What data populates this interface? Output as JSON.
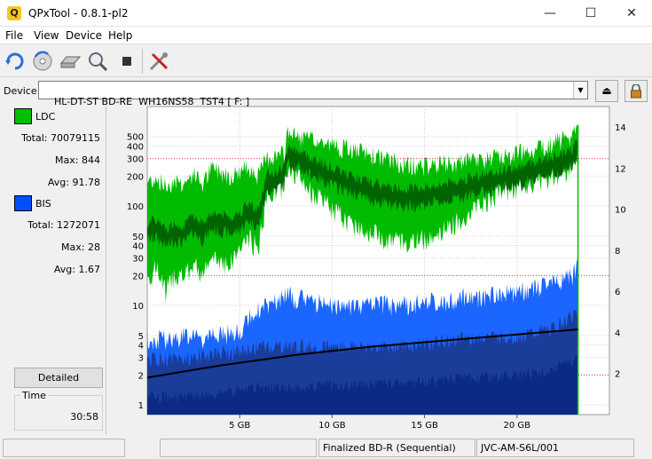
{
  "window": {
    "title": "QPxTool - 0.8.1-pl2",
    "app_icon_glyph": "Q"
  },
  "menu": {
    "items": [
      "File",
      "View",
      "Device",
      "Help"
    ]
  },
  "toolbar": {
    "icons": [
      "refresh-icon",
      "disc-scan-icon",
      "drive-icon",
      "magnifier-icon",
      "stop-icon",
      "tools-icon"
    ]
  },
  "device": {
    "label": "Device:",
    "value": "HL-DT-ST BD-RE  WH16NS58  TST4 [ F: ]"
  },
  "legend": {
    "ldc": {
      "name": "LDC",
      "color": "#00c000",
      "total_label": "Total:",
      "total": "70079115",
      "max_label": "Max:",
      "max": "844",
      "avg_label": "Avg:",
      "avg": "91.78"
    },
    "bis": {
      "name": "BIS",
      "color": "#0050ff",
      "total_label": "Total:",
      "total": "1272071",
      "max_label": "Max:",
      "max": "28",
      "avg_label": "Avg:",
      "avg": "1.67"
    }
  },
  "detailed_button": "Detailed",
  "time": {
    "label": "Time",
    "value": "30:58"
  },
  "status": {
    "pane3": "Finalized BD-R (Sequential)",
    "pane4": "JVC-AM-S6L/001"
  },
  "chart_data": {
    "type": "area",
    "x_unit": "GB",
    "x_range": [
      0,
      25
    ],
    "x_ticks": [
      5,
      10,
      15,
      20
    ],
    "x_tick_labels": [
      "5 GB",
      "10 GB",
      "15 GB",
      "20 GB"
    ],
    "y_left_ticks": [
      1,
      2,
      3,
      4,
      5,
      10,
      20,
      30,
      40,
      50,
      100,
      200,
      300,
      400,
      500
    ],
    "y_left_scale": "log",
    "y_left_range": [
      0.8,
      1000
    ],
    "y_right_ticks": [
      2,
      4,
      6,
      8,
      10,
      12,
      14
    ],
    "y_right_range": [
      0,
      15
    ],
    "red_dotted_lines": [
      300,
      20,
      2
    ],
    "colors": {
      "ldc_max": "#00bb00",
      "ldc_avg": "#006400",
      "bis_max": "#1a66ff",
      "bis_avg": "#1a3d9a",
      "bis_low": "#0a2a86",
      "speed": "#000000"
    },
    "ldc_max": [
      [
        0.0,
        180
      ],
      [
        0.5,
        200
      ],
      [
        1.0,
        160
      ],
      [
        1.5,
        190
      ],
      [
        2.0,
        170
      ],
      [
        2.5,
        220
      ],
      [
        3.0,
        170
      ],
      [
        3.5,
        250
      ],
      [
        4.0,
        230
      ],
      [
        4.5,
        210
      ],
      [
        5.0,
        230
      ],
      [
        5.5,
        260
      ],
      [
        6.0,
        210
      ],
      [
        6.5,
        320
      ],
      [
        7.0,
        330
      ],
      [
        7.4,
        340
      ],
      [
        7.6,
        600
      ],
      [
        8.0,
        520
      ],
      [
        9.0,
        470
      ],
      [
        10.0,
        420
      ],
      [
        11.0,
        380
      ],
      [
        12.0,
        340
      ],
      [
        13.0,
        300
      ],
      [
        14.0,
        270
      ],
      [
        15.0,
        260
      ],
      [
        16.0,
        270
      ],
      [
        17.0,
        280
      ],
      [
        18.0,
        300
      ],
      [
        19.0,
        320
      ],
      [
        20.0,
        350
      ],
      [
        21.0,
        400
      ],
      [
        22.0,
        450
      ],
      [
        23.0,
        520
      ],
      [
        23.3,
        650
      ]
    ],
    "ldc_mean": [
      [
        0.0,
        70
      ],
      [
        0.5,
        75
      ],
      [
        1.0,
        60
      ],
      [
        1.5,
        70
      ],
      [
        2.0,
        65
      ],
      [
        2.5,
        85
      ],
      [
        3.0,
        70
      ],
      [
        3.5,
        90
      ],
      [
        4.0,
        85
      ],
      [
        4.5,
        80
      ],
      [
        5.0,
        90
      ],
      [
        5.5,
        110
      ],
      [
        6.0,
        95
      ],
      [
        6.5,
        220
      ],
      [
        7.0,
        230
      ],
      [
        7.4,
        260
      ],
      [
        7.6,
        420
      ],
      [
        8.0,
        380
      ],
      [
        9.0,
        310
      ],
      [
        10.0,
        250
      ],
      [
        11.0,
        210
      ],
      [
        12.0,
        180
      ],
      [
        13.0,
        160
      ],
      [
        14.0,
        155
      ],
      [
        15.0,
        160
      ],
      [
        16.0,
        170
      ],
      [
        17.0,
        190
      ],
      [
        18.0,
        210
      ],
      [
        19.0,
        230
      ],
      [
        20.0,
        250
      ],
      [
        21.0,
        290
      ],
      [
        22.0,
        330
      ],
      [
        23.0,
        380
      ],
      [
        23.3,
        480
      ]
    ],
    "ldc_min": [
      [
        0.0,
        20
      ],
      [
        0.5,
        25
      ],
      [
        1.0,
        15
      ],
      [
        1.5,
        22
      ],
      [
        2.0,
        20
      ],
      [
        2.5,
        28
      ],
      [
        3.0,
        22
      ],
      [
        3.5,
        30
      ],
      [
        4.0,
        30
      ],
      [
        4.5,
        28
      ],
      [
        5.0,
        40
      ],
      [
        5.5,
        50
      ],
      [
        6.0,
        40
      ],
      [
        6.5,
        140
      ],
      [
        7.0,
        150
      ],
      [
        7.4,
        170
      ],
      [
        7.6,
        280
      ],
      [
        8.0,
        220
      ],
      [
        9.0,
        140
      ],
      [
        10.0,
        100
      ],
      [
        11.0,
        70
      ],
      [
        12.0,
        60
      ],
      [
        13.0,
        50
      ],
      [
        14.0,
        45
      ],
      [
        15.0,
        50
      ],
      [
        16.0,
        60
      ],
      [
        17.0,
        80
      ],
      [
        18.0,
        110
      ],
      [
        19.0,
        140
      ],
      [
        20.0,
        160
      ],
      [
        21.0,
        190
      ],
      [
        22.0,
        220
      ],
      [
        23.0,
        260
      ],
      [
        23.3,
        320
      ]
    ],
    "bis_max": [
      [
        0.0,
        5
      ],
      [
        1.0,
        5
      ],
      [
        2.0,
        5.5
      ],
      [
        3.0,
        5
      ],
      [
        4.0,
        5.5
      ],
      [
        5.0,
        6
      ],
      [
        5.5,
        8
      ],
      [
        6.0,
        10
      ],
      [
        7.0,
        12
      ],
      [
        7.5,
        14
      ],
      [
        8.0,
        13
      ],
      [
        9.0,
        12
      ],
      [
        10.0,
        11
      ],
      [
        11.0,
        11
      ],
      [
        12.0,
        11
      ],
      [
        13.0,
        11
      ],
      [
        14.0,
        11
      ],
      [
        15.0,
        12
      ],
      [
        16.0,
        12
      ],
      [
        17.0,
        13
      ],
      [
        18.0,
        13
      ],
      [
        19.0,
        14
      ],
      [
        20.0,
        15
      ],
      [
        21.0,
        16
      ],
      [
        22.0,
        18
      ],
      [
        23.0,
        22
      ],
      [
        23.3,
        28
      ]
    ],
    "bis_mid": [
      [
        0.0,
        3
      ],
      [
        2.0,
        3
      ],
      [
        4.0,
        3.5
      ],
      [
        5.0,
        3.5
      ],
      [
        6.0,
        4
      ],
      [
        8.0,
        4
      ],
      [
        10.0,
        4
      ],
      [
        12.0,
        4
      ],
      [
        14.0,
        4
      ],
      [
        16.0,
        4.5
      ],
      [
        18.0,
        5
      ],
      [
        20.0,
        5
      ],
      [
        22.0,
        6
      ],
      [
        23.3,
        9
      ]
    ],
    "bis_low": [
      [
        0.0,
        1.2
      ],
      [
        2.0,
        1.2
      ],
      [
        4.0,
        1.3
      ],
      [
        6.0,
        1.5
      ],
      [
        8.0,
        1.5
      ],
      [
        10.0,
        1.6
      ],
      [
        12.0,
        1.6
      ],
      [
        14.0,
        1.7
      ],
      [
        16.0,
        1.8
      ],
      [
        18.0,
        1.9
      ],
      [
        20.0,
        2
      ],
      [
        22.0,
        2.3
      ],
      [
        23.3,
        3
      ]
    ],
    "speed": [
      [
        0.0,
        1.8
      ],
      [
        2.0,
        2.1
      ],
      [
        4.0,
        2.4
      ],
      [
        6.0,
        2.65
      ],
      [
        8.0,
        2.9
      ],
      [
        10.0,
        3.1
      ],
      [
        12.0,
        3.3
      ],
      [
        14.0,
        3.45
      ],
      [
        16.0,
        3.6
      ],
      [
        18.0,
        3.75
      ],
      [
        20.0,
        3.9
      ],
      [
        22.0,
        4.05
      ],
      [
        23.3,
        4.15
      ]
    ],
    "end_spike_x": 23.3
  }
}
